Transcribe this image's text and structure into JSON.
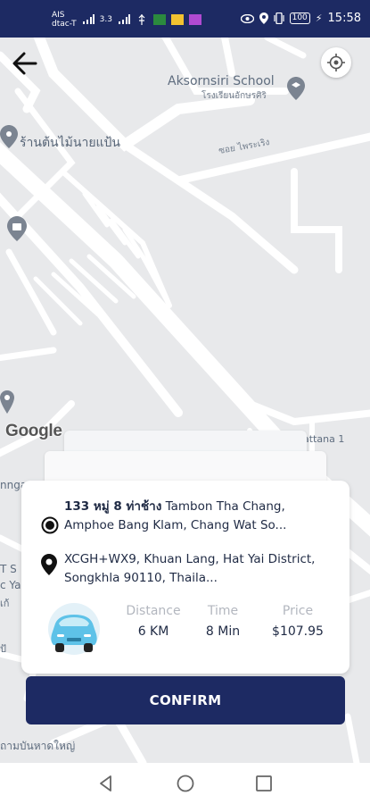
{
  "status_bar": {
    "carrier_top": "AIS",
    "carrier_bottom": "dtac-T",
    "speed": "3.3",
    "battery": "100",
    "time": "15:58"
  },
  "map": {
    "poi_school_en": "Aksornsiri School",
    "poi_school_th": "โรงเรียนอักษรศิริ",
    "poi_shop": "ร้านต้นไม้นายแป้น",
    "road_label_1": "ซอย ไพระเริง",
    "road_label_2": "attana 1",
    "edge_label_1": "nnga",
    "edge_label_2": "T S",
    "edge_label_3": "c Ya",
    "edge_label_4": "เก้",
    "edge_label_5": "ปั",
    "bottom_label": "ถามบันหาดใหญ่",
    "google_logo": "Google"
  },
  "trip": {
    "pickup_bold": "133 หมู่ 8 ท่าช้าง",
    "pickup_rest": "Tambon Tha Chang, Amphoe Bang Klam, Chang Wat So...",
    "dropoff": "XCGH+WX9, Khuan Lang, Hat Yai District, Songkhla 90110, Thaila...",
    "distance_label": "Distance",
    "distance_value": "6 KM",
    "time_label": "Time",
    "time_value": "8 Min",
    "price_label": "Price",
    "price_value": "$107.95",
    "confirm_label": "CONFIRM"
  },
  "colors": {
    "brand": "#1d2a63",
    "car": "#5ec2e8"
  },
  "icons": [
    "back-arrow-icon",
    "locate-icon",
    "radio-pickup-icon",
    "pin-dropoff-icon",
    "car-icon",
    "nav-back-icon",
    "nav-home-icon",
    "nav-recents-icon"
  ]
}
